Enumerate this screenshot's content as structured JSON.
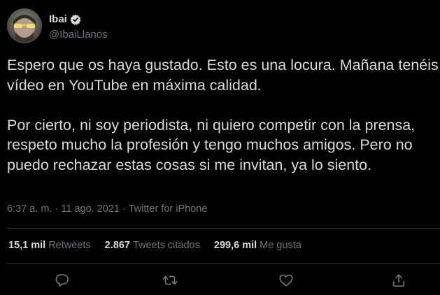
{
  "user": {
    "display_name": "Ibai",
    "handle": "@IbaiLlanos",
    "verified_icon": "verified-badge-icon"
  },
  "tweet": {
    "text": "Espero que os haya gustado. Esto es una locura. Mañana tenéis el vídeo en YouTube en máxima calidad.\n\nPor cierto, ni soy periodista, ni quiero competir con la prensa, respeto mucho la profesión y tengo muchos amigos. Pero no puedo rechazar estas cosas si me invitan, ya lo siento.",
    "meta": "6:37 a. m. · 11 ago. 2021 · Twitter for iPhone"
  },
  "stats": {
    "retweets_count": "15,1 mil",
    "retweets_label": "Retweets",
    "quotes_count": "2.867",
    "quotes_label": "Tweets citados",
    "likes_count": "299,6 mil",
    "likes_label": "Me gusta"
  },
  "actions": [
    "reply-icon",
    "retweet-icon",
    "like-icon",
    "share-icon"
  ],
  "colors": {
    "background": "#000000",
    "text": "#d9d9d9",
    "secondary": "#6e767d",
    "divider": "#2f3336"
  }
}
